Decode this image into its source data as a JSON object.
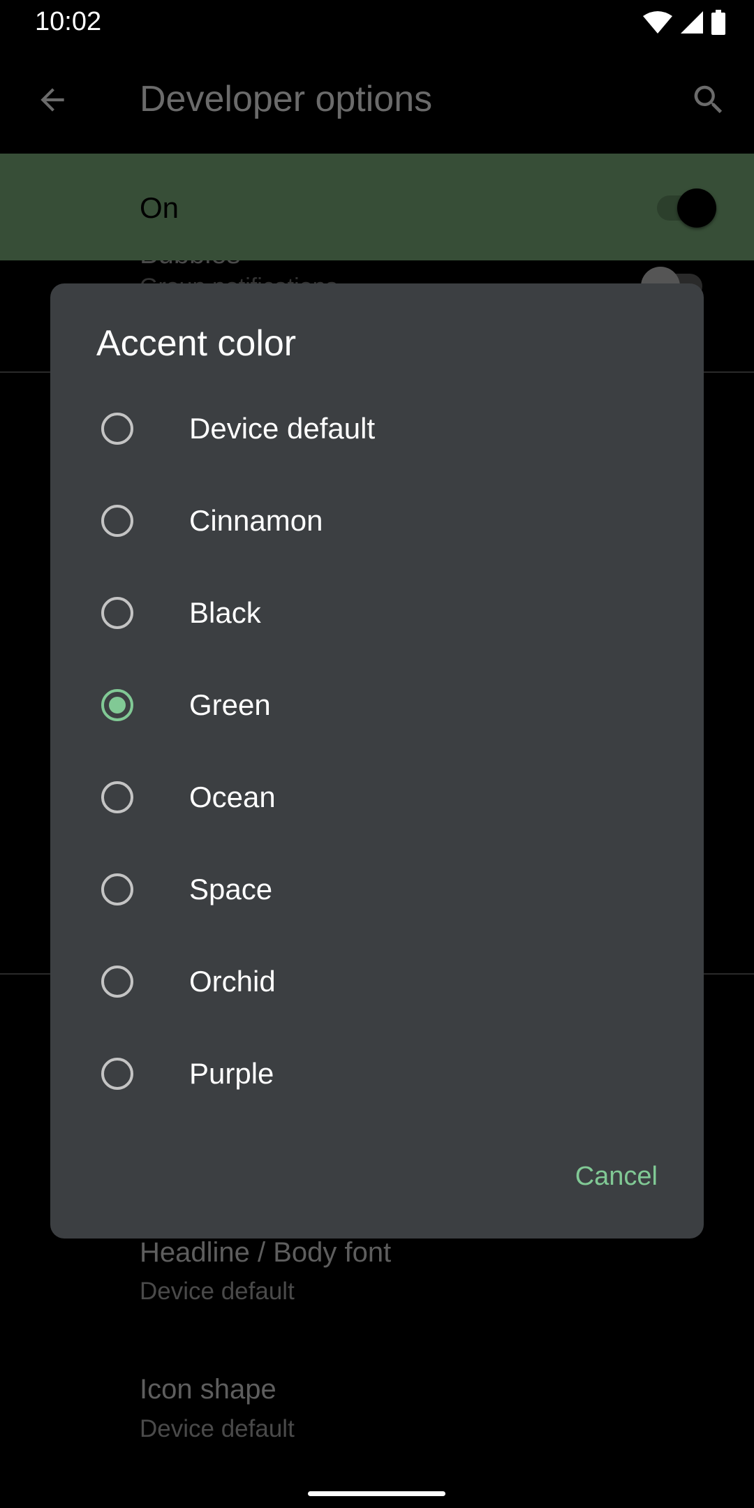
{
  "status_bar": {
    "time": "10:02",
    "icons": [
      "wifi-icon",
      "signal-icon",
      "battery-icon"
    ]
  },
  "toolbar": {
    "title": "Developer options",
    "back_icon": "arrow-back-icon",
    "search_icon": "search-icon"
  },
  "main_switch": {
    "label": "On",
    "checked": true,
    "color": "#374e37"
  },
  "background_items": [
    {
      "title": "Bubbles",
      "summary": "Group notifications"
    },
    {
      "title": "Headline / Body font",
      "summary": "Device default"
    },
    {
      "title": "Icon shape",
      "summary": "Device default"
    }
  ],
  "dialog": {
    "title": "Accent color",
    "options": [
      {
        "label": "Device default",
        "selected": false
      },
      {
        "label": "Cinnamon",
        "selected": false
      },
      {
        "label": "Black",
        "selected": false
      },
      {
        "label": "Green",
        "selected": true
      },
      {
        "label": "Ocean",
        "selected": false
      },
      {
        "label": "Space",
        "selected": false
      },
      {
        "label": "Orchid",
        "selected": false
      },
      {
        "label": "Purple",
        "selected": false
      }
    ],
    "cancel_label": "Cancel",
    "accent": "#81c995"
  }
}
